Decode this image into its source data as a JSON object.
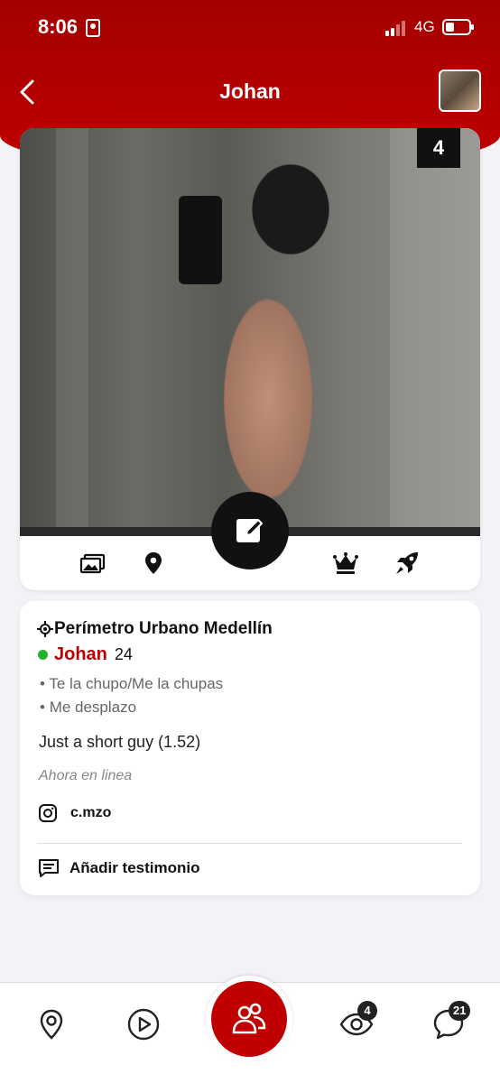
{
  "status_bar": {
    "time": "8:06",
    "network": "4G"
  },
  "nav": {
    "title": "Johan",
    "back_icon": "chevron-left-icon"
  },
  "photo": {
    "count": "4"
  },
  "icon_row": {
    "items": [
      "photos-icon",
      "location-pin-icon",
      "edit-icon",
      "crown-icon",
      "rocket-icon"
    ]
  },
  "profile": {
    "location": "Perímetro Urbano Medellín",
    "name": "Johan",
    "age": "24",
    "tags": [
      "Te la chupo/Me la chupas",
      "Me desplazo"
    ],
    "bio": "Just a short guy (1.52)",
    "presence": "Ahora en linea",
    "instagram": "c.mzo",
    "add_testimonial": "Añadir testimonio"
  },
  "tabbar": {
    "items": [
      "map-pin-icon",
      "play-icon",
      "people-icon",
      "eye-icon",
      "chat-icon"
    ],
    "visits_badge": "4",
    "chat_badge": "21"
  },
  "colors": {
    "brand_red": "#c00000",
    "online_green": "#22b22e"
  }
}
